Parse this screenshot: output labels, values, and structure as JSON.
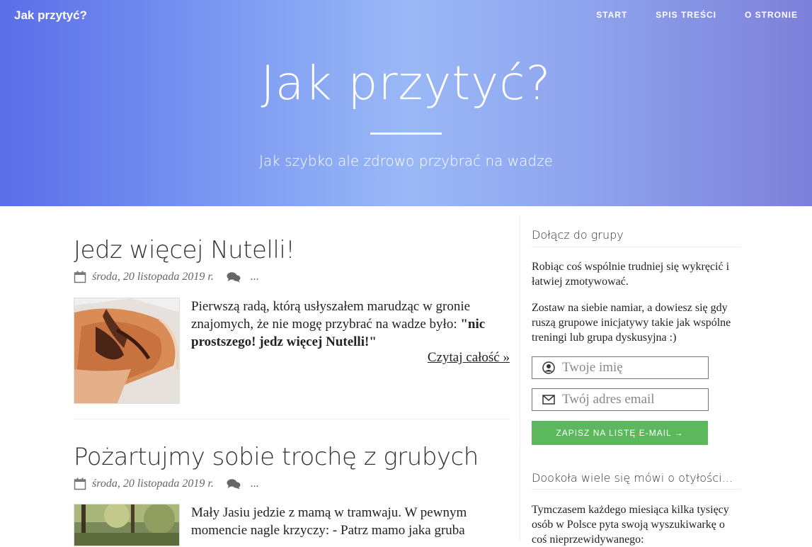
{
  "header": {
    "brand": "Jak przytyć?",
    "nav": [
      "START",
      "SPIS TREŚCI",
      "O STRONIE"
    ],
    "title": "Jak przytyć?",
    "subtitle": "Jak szybko ale zdrowo przybrać na wadze"
  },
  "posts": [
    {
      "title": "Jedz więcej Nutelli!",
      "date": "środa, 20 listopada 2019 r.",
      "comments": "...",
      "excerpt_plain": "Pierwszą radą, którą usłyszałem marudząc w gronie znajomych, że nie mogę przybrać na wadze było: ",
      "excerpt_bold": "\"nic prostszego! jedz więcej Nutelli!\"",
      "read_more": "Czytaj całość »"
    },
    {
      "title": "Pożartujmy sobie trochę z grubych",
      "date": "środa, 20 listopada 2019 r.",
      "comments": "...",
      "excerpt_plain": "Mały Jasiu jedzie z mamą w tramwaju. W pewnym momencie nagle krzyczy: - Patrz mamo jaka gruba",
      "excerpt_bold": "",
      "read_more": ""
    }
  ],
  "sidebar": {
    "group": {
      "title": "Dołącz do grupy",
      "text1": "Robiąc coś wspólnie trudniej się wykręcić i łatwiej zmotywować.",
      "text2": "Zostaw na siebie namiar, a dowiesz się gdy ruszą grupowe inicjatywy takie jak wspólne treningi lub grupa dyskusyjna :)",
      "name_placeholder": "Twoje imię",
      "email_placeholder": "Twój adres email",
      "submit": "ZAPISZ NA LISTĘ E-MAIL →"
    },
    "obesity": {
      "title": "Dookoła wiele się mówi o otyłości...",
      "text": "Tymczasem każdego miesiąca kilka tysięcy osób w Polsce pyta swoją wyszukiwarkę o coś nieprzewidywanego:"
    }
  },
  "colors": {
    "hero_start": "#5a6ee8",
    "hero_mid": "#9ab8f6",
    "hero_end": "#7d80d9",
    "button_green": "#5cb85c"
  },
  "icons": [
    "calendar-icon",
    "comments-icon",
    "user-icon",
    "envelope-icon"
  ]
}
